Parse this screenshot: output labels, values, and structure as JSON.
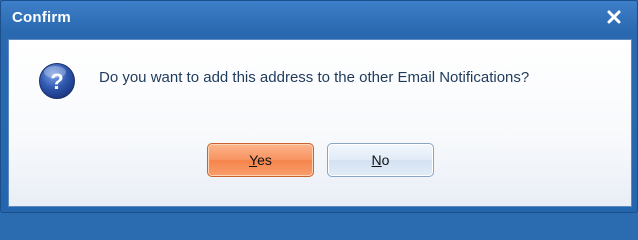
{
  "window": {
    "title": "Confirm",
    "close_icon": "close-icon"
  },
  "message": {
    "icon": "question-icon",
    "text": "Do you want to add this address to the other Email Notifications?"
  },
  "buttons": {
    "yes": {
      "mnemonic": "Y",
      "rest": "es",
      "label": "Yes"
    },
    "no": {
      "mnemonic": "N",
      "rest": "o",
      "label": "No"
    }
  },
  "colors": {
    "title_bar": "#2a69b0",
    "default_button": "#f79360",
    "secondary_button": "#dce7f5",
    "icon_blue": "#2a4f9e"
  }
}
